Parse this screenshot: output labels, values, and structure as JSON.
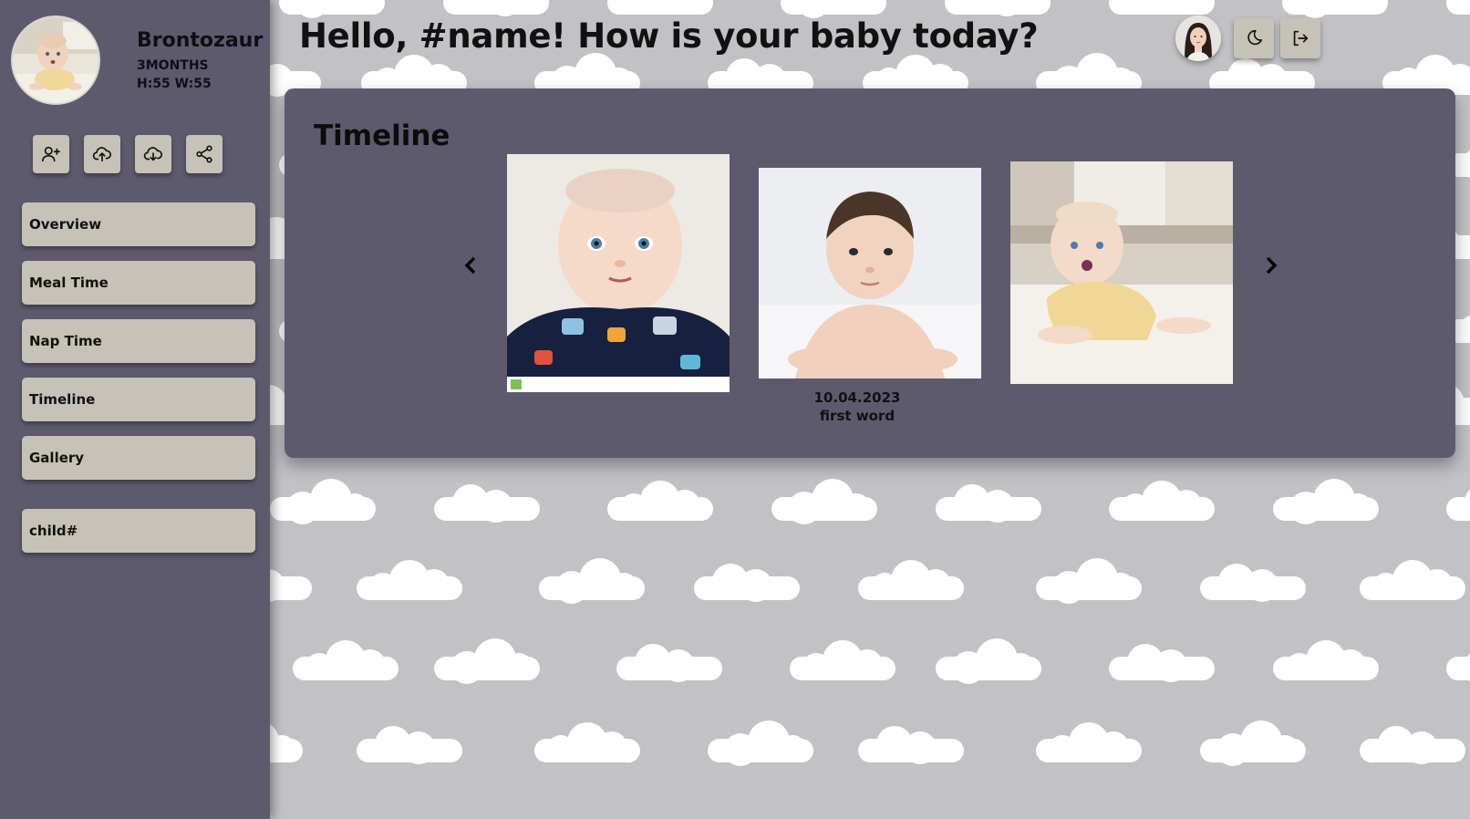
{
  "header": {
    "greeting": "Hello, #name! How is your baby today?"
  },
  "profile": {
    "name": "Brontozaur",
    "age": "3MONTHS",
    "measurements": "H:55 W:55"
  },
  "sidebar": {
    "actions": [
      {
        "icon": "add-user-icon"
      },
      {
        "icon": "cloud-upload-icon"
      },
      {
        "icon": "cloud-download-icon"
      },
      {
        "icon": "share-icon"
      }
    ],
    "items": [
      {
        "label": "Overview"
      },
      {
        "label": "Meal Time"
      },
      {
        "label": "Nap Time"
      },
      {
        "label": "Timeline"
      },
      {
        "label": "Gallery"
      }
    ],
    "child_label": "child#"
  },
  "top_buttons": [
    {
      "icon": "moon-icon"
    },
    {
      "icon": "logout-icon"
    }
  ],
  "timeline": {
    "title": "Timeline",
    "photos": [
      {
        "alt": "baby photo 1"
      },
      {
        "alt": "baby photo 2",
        "date": "10.04.2023",
        "caption": "first word"
      },
      {
        "alt": "baby photo 3"
      }
    ],
    "prev_icon": "chevron-left-icon",
    "next_icon": "chevron-right-icon"
  },
  "colors": {
    "sidebar": "#5e5a6e",
    "button": "#c7c2b7",
    "background": "#c2c1c6",
    "cloud": "#ffffff"
  }
}
